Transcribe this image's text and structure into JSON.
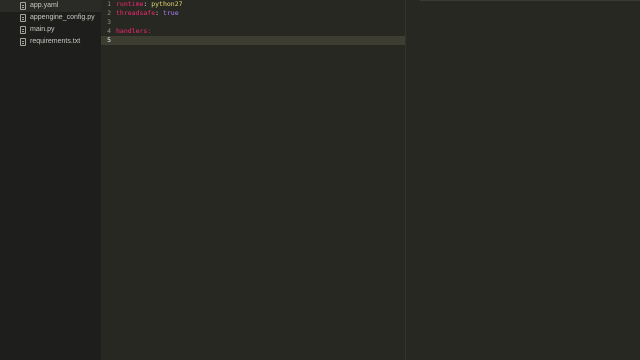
{
  "sidebar": {
    "files": [
      {
        "name": "app.yaml",
        "icon": "file-icon",
        "active": true
      },
      {
        "name": "appengine_config.py",
        "icon": "file-icon",
        "active": false
      },
      {
        "name": "main.py",
        "icon": "file-icon",
        "active": false
      },
      {
        "name": "requirements.txt",
        "icon": "file-icon",
        "active": false
      }
    ]
  },
  "editor": {
    "line_numbers": [
      "1",
      "2",
      "3",
      "4",
      "5"
    ],
    "current_line": 5,
    "lines": [
      {
        "key": "runtime",
        "sep": ": ",
        "value": "python27",
        "value_type": "string"
      },
      {
        "key": "threadsafe",
        "sep": ": ",
        "value": "true",
        "value_type": "bool"
      },
      {
        "key": "",
        "sep": "",
        "value": "",
        "value_type": ""
      },
      {
        "key": "handlers",
        "sep": ":",
        "value": "",
        "value_type": ""
      },
      {
        "key": "",
        "sep": "",
        "value": "",
        "value_type": ""
      }
    ]
  },
  "colors": {
    "background": "#272822",
    "sidebar_background": "#1e1f1c",
    "key": "#f92672",
    "string": "#e6db74",
    "bool": "#ae81ff",
    "current_line": "#3e3d32"
  }
}
